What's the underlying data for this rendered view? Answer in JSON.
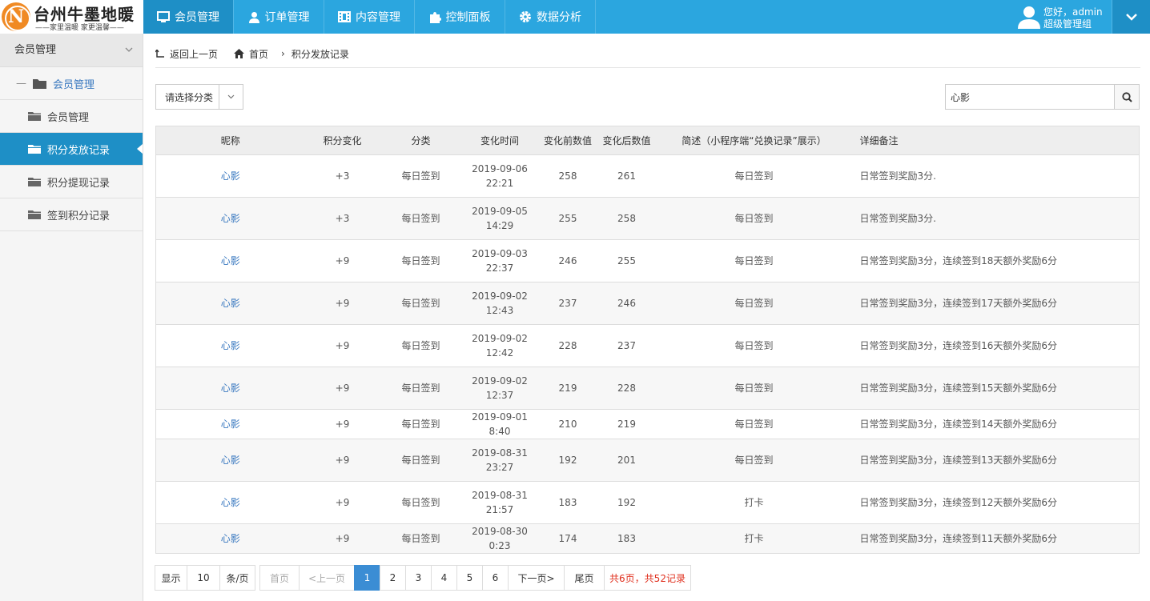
{
  "logo": {
    "mark": "N",
    "title": "台州牛墨地暖",
    "subtitle": "——家里温暖 家更温馨——"
  },
  "nav": [
    {
      "label": "会员管理",
      "icon": "monitor-icon",
      "active": true
    },
    {
      "label": "订单管理",
      "icon": "user-icon"
    },
    {
      "label": "内容管理",
      "icon": "film-icon"
    },
    {
      "label": "控制面板",
      "icon": "puzzle-icon"
    },
    {
      "label": "数据分析",
      "icon": "gear-icon"
    }
  ],
  "user": {
    "greeting": "您好，admin",
    "role": "超级管理组"
  },
  "sidebar": {
    "header": "会员管理",
    "group": "会员管理",
    "items": [
      {
        "label": "会员管理"
      },
      {
        "label": "积分发放记录",
        "active": true
      },
      {
        "label": "积分提现记录"
      },
      {
        "label": "签到积分记录"
      }
    ]
  },
  "breadcrumb": {
    "back": "返回上一页",
    "home": "首页",
    "current": "积分发放记录"
  },
  "filter": {
    "category_placeholder": "请选择分类"
  },
  "search": {
    "value": "心影"
  },
  "table": {
    "headers": [
      "昵称",
      "积分变化",
      "分类",
      "变化时间",
      "变化前数值",
      "变化后数值",
      "简述（小程序端“兑换记录”展示）",
      "详细备注"
    ],
    "rows": [
      {
        "nick": "心影",
        "change": "+3",
        "category": "每日签到",
        "date": "2019-09-06",
        "time": "22:21",
        "before": "258",
        "after": "261",
        "summary": "每日签到",
        "note": "日常签到奖励3分."
      },
      {
        "nick": "心影",
        "change": "+3",
        "category": "每日签到",
        "date": "2019-09-05",
        "time": "14:29",
        "before": "255",
        "after": "258",
        "summary": "每日签到",
        "note": "日常签到奖励3分."
      },
      {
        "nick": "心影",
        "change": "+9",
        "category": "每日签到",
        "date": "2019-09-03",
        "time": "22:37",
        "before": "246",
        "after": "255",
        "summary": "每日签到",
        "note": "日常签到奖励3分，连续签到18天额外奖励6分"
      },
      {
        "nick": "心影",
        "change": "+9",
        "category": "每日签到",
        "date": "2019-09-02",
        "time": "12:43",
        "before": "237",
        "after": "246",
        "summary": "每日签到",
        "note": "日常签到奖励3分，连续签到17天额外奖励6分"
      },
      {
        "nick": "心影",
        "change": "+9",
        "category": "每日签到",
        "date": "2019-09-02",
        "time": "12:42",
        "before": "228",
        "after": "237",
        "summary": "每日签到",
        "note": "日常签到奖励3分，连续签到16天额外奖励6分"
      },
      {
        "nick": "心影",
        "change": "+9",
        "category": "每日签到",
        "date": "2019-09-02",
        "time": "12:37",
        "before": "219",
        "after": "228",
        "summary": "每日签到",
        "note": "日常签到奖励3分，连续签到15天额外奖励6分"
      },
      {
        "nick": "心影",
        "change": "+9",
        "category": "每日签到",
        "date": "2019-09-01 8:40",
        "time": "",
        "before": "210",
        "after": "219",
        "summary": "每日签到",
        "note": "日常签到奖励3分，连续签到14天额外奖励6分"
      },
      {
        "nick": "心影",
        "change": "+9",
        "category": "每日签到",
        "date": "2019-08-31",
        "time": "23:27",
        "before": "192",
        "after": "201",
        "summary": "每日签到",
        "note": "日常签到奖励3分，连续签到13天额外奖励6分"
      },
      {
        "nick": "心影",
        "change": "+9",
        "category": "每日签到",
        "date": "2019-08-31",
        "time": "21:57",
        "before": "183",
        "after": "192",
        "summary": "打卡",
        "note": "日常签到奖励3分，连续签到12天额外奖励6分"
      },
      {
        "nick": "心影",
        "change": "+9",
        "category": "每日签到",
        "date": "2019-08-30 0:23",
        "time": "",
        "before": "174",
        "after": "183",
        "summary": "打卡",
        "note": "日常签到奖励3分，连续签到11天额外奖励6分"
      }
    ]
  },
  "pager": {
    "show": "显示",
    "per_page": "10",
    "unit": "条/页",
    "first": "首页",
    "prev": "<上一页",
    "pages": [
      "1",
      "2",
      "3",
      "4",
      "5",
      "6"
    ],
    "current": "1",
    "next": "下一页>",
    "last": "尾页",
    "total": "共6页，共52记录"
  },
  "colors": {
    "topbar": "#2ba6df",
    "active": "#1e8fc6",
    "link": "#3a79c0",
    "total": "#e0301e"
  }
}
